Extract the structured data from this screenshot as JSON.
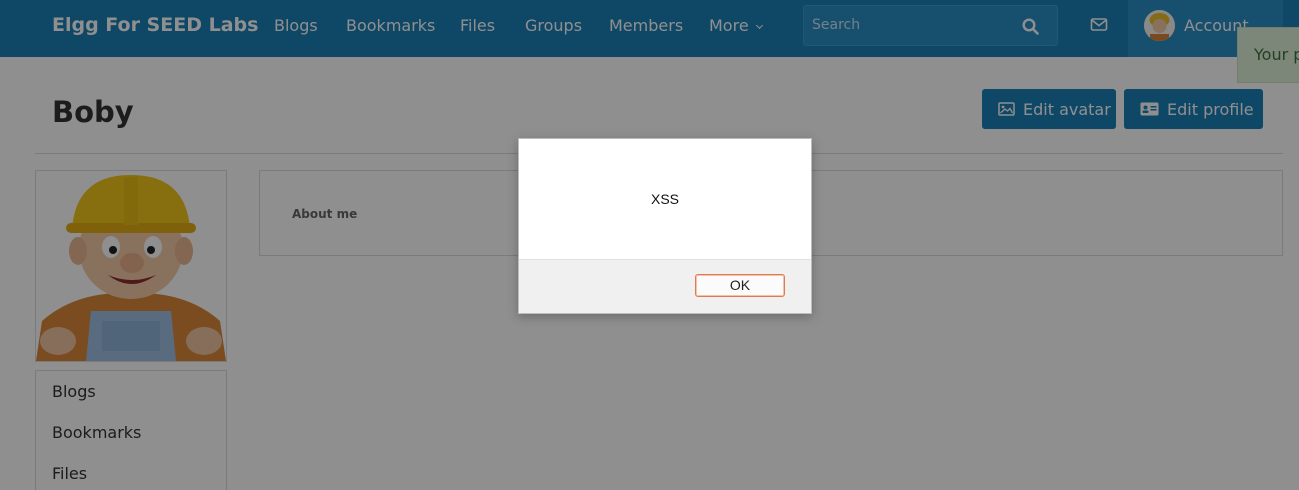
{
  "brand": "Elgg For SEED Labs",
  "nav": {
    "items": [
      "Blogs",
      "Bookmarks",
      "Files",
      "Groups",
      "Members"
    ],
    "more_label": "More"
  },
  "search": {
    "placeholder": "Search"
  },
  "account": {
    "label": "Account"
  },
  "toast": {
    "text": "Your p"
  },
  "profile": {
    "name": "Boby",
    "edit_avatar_label": "Edit avatar",
    "edit_profile_label": "Edit profile",
    "about_label": "About me"
  },
  "owner_menu": {
    "items": [
      "Blogs",
      "Bookmarks",
      "Files"
    ]
  },
  "dialog": {
    "message": "XSS",
    "ok_label": "OK"
  },
  "colors": {
    "topbar": "#1a80b6",
    "button": "#1a80b6",
    "overlay": "rgba(0,0,0,0.44)",
    "toast_bg": "#dff0d8",
    "ok_border": "#e17b4f"
  },
  "icons": {
    "search": "search-icon",
    "mail": "envelope-icon",
    "edit_avatar": "image-icon",
    "edit_profile": "id-card-icon",
    "more": "chevron-down-icon"
  }
}
